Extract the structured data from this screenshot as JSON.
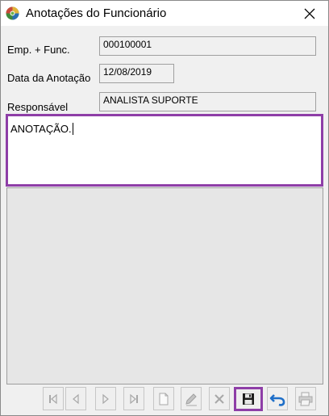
{
  "window": {
    "title": "Anotações do Funcionário"
  },
  "form": {
    "emp_func_label": "Emp. + Func.",
    "emp_func_value": "000100001",
    "date_label": "Data da Anotação",
    "date_value": "12/08/2019",
    "responsible_label": "Responsável",
    "responsible_value": "ANALISTA SUPORTE",
    "note_text": "ANOTAÇÃO."
  },
  "toolbar": {
    "buttons": [
      {
        "name": "first-record",
        "icon": "first-icon",
        "enabled": false
      },
      {
        "name": "previous-record",
        "icon": "previous-icon",
        "enabled": false
      },
      {
        "name": "next-record",
        "icon": "next-icon",
        "enabled": false
      },
      {
        "name": "last-record",
        "icon": "last-icon",
        "enabled": false
      },
      {
        "name": "new-record",
        "icon": "new-document-icon",
        "enabled": false
      },
      {
        "name": "edit-record",
        "icon": "pencil-icon",
        "enabled": false
      },
      {
        "name": "delete-record",
        "icon": "delete-x-icon",
        "enabled": false
      },
      {
        "name": "save-record",
        "icon": "save-floppy-icon",
        "enabled": true
      },
      {
        "name": "undo-record",
        "icon": "undo-arrow-icon",
        "enabled": true
      },
      {
        "name": "print-record",
        "icon": "printer-icon",
        "enabled": false
      }
    ]
  },
  "colors": {
    "highlight": "#8e3ea7",
    "window_bg": "#f0f0f0",
    "disabled_icon": "#a8a8a8",
    "undo_blue": "#1f6fc8"
  }
}
